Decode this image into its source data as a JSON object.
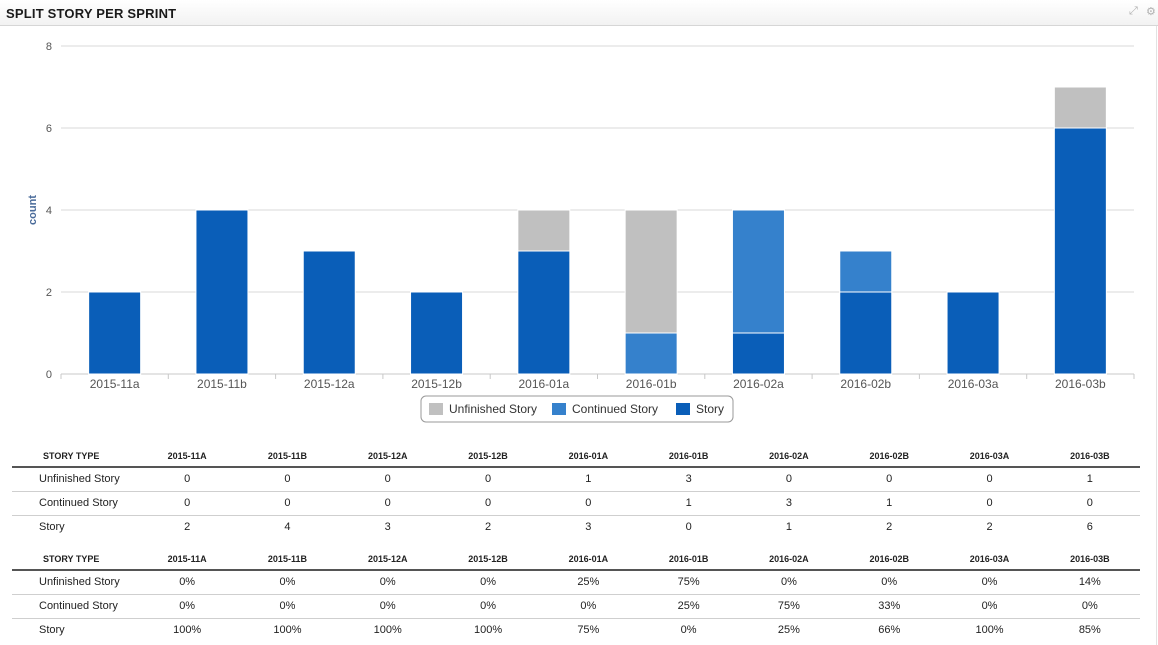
{
  "panel": {
    "title": "SPLIT STORY PER SPRINT",
    "expand_icon": "expand-icon",
    "settings_icon": "gear-icon"
  },
  "colors": {
    "unfinished": "#c0c0c0",
    "continued": "#3581cc",
    "story": "#0a5eb8",
    "grid": "#d8d8d8"
  },
  "chart_data": {
    "type": "bar",
    "stacked": true,
    "categories": [
      "2015-11a",
      "2015-11b",
      "2015-12a",
      "2015-12b",
      "2016-01a",
      "2016-01b",
      "2016-02a",
      "2016-02b",
      "2016-03a",
      "2016-03b"
    ],
    "series": [
      {
        "name": "Story",
        "color": "#0a5eb8",
        "values": [
          2,
          4,
          3,
          2,
          3,
          0,
          1,
          2,
          2,
          6
        ]
      },
      {
        "name": "Continued Story",
        "color": "#3581cc",
        "values": [
          0,
          0,
          0,
          0,
          0,
          1,
          3,
          1,
          0,
          0
        ]
      },
      {
        "name": "Unfinished Story",
        "color": "#c0c0c0",
        "values": [
          0,
          0,
          0,
          0,
          1,
          3,
          0,
          0,
          0,
          1
        ]
      }
    ],
    "legend_order": [
      "Unfinished Story",
      "Continued Story",
      "Story"
    ],
    "ylabel": "count",
    "xlabel": "",
    "ylim": [
      0,
      8
    ],
    "yticks": [
      0,
      2,
      4,
      6,
      8
    ],
    "grid": true,
    "legend_position": "bottom-center"
  },
  "tables": [
    {
      "header_label": "STORY TYPE",
      "columns": [
        "2015-11A",
        "2015-11B",
        "2015-12A",
        "2015-12B",
        "2016-01A",
        "2016-01B",
        "2016-02A",
        "2016-02B",
        "2016-03A",
        "2016-03B"
      ],
      "rows": [
        {
          "label": "Unfinished Story",
          "cells": [
            "0",
            "0",
            "0",
            "0",
            "1",
            "3",
            "0",
            "0",
            "0",
            "1"
          ]
        },
        {
          "label": "Continued Story",
          "cells": [
            "0",
            "0",
            "0",
            "0",
            "0",
            "1",
            "3",
            "1",
            "0",
            "0"
          ]
        },
        {
          "label": "Story",
          "cells": [
            "2",
            "4",
            "3",
            "2",
            "3",
            "0",
            "1",
            "2",
            "2",
            "6"
          ]
        }
      ]
    },
    {
      "header_label": "STORY TYPE",
      "columns": [
        "2015-11A",
        "2015-11B",
        "2015-12A",
        "2015-12B",
        "2016-01A",
        "2016-01B",
        "2016-02A",
        "2016-02B",
        "2016-03A",
        "2016-03B"
      ],
      "rows": [
        {
          "label": "Unfinished Story",
          "cells": [
            "0%",
            "0%",
            "0%",
            "0%",
            "25%",
            "75%",
            "0%",
            "0%",
            "0%",
            "14%"
          ]
        },
        {
          "label": "Continued Story",
          "cells": [
            "0%",
            "0%",
            "0%",
            "0%",
            "0%",
            "25%",
            "75%",
            "33%",
            "0%",
            "0%"
          ]
        },
        {
          "label": "Story",
          "cells": [
            "100%",
            "100%",
            "100%",
            "100%",
            "75%",
            "0%",
            "25%",
            "66%",
            "100%",
            "85%"
          ]
        }
      ]
    }
  ]
}
